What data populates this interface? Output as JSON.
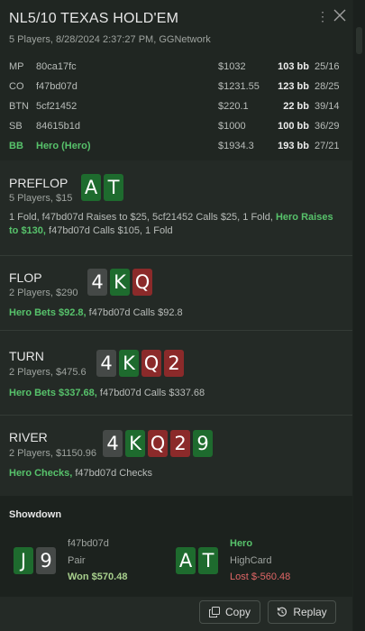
{
  "header": {
    "title": "NL5/10 TEXAS HOLD'EM",
    "subtitle": "5 Players, 8/28/2024 2:37:27 PM, GGNetwork"
  },
  "players": [
    {
      "pos": "MP",
      "name": "80ca17fc",
      "stack": "$1032",
      "bb": "103 bb",
      "stat": "25/16"
    },
    {
      "pos": "CO",
      "name": "f47bd07d",
      "stack": "$1231.55",
      "bb": "123 bb",
      "stat": "28/25"
    },
    {
      "pos": "BTN",
      "name": "5cf21452",
      "stack": "$220.1",
      "bb": "22 bb",
      "stat": "39/14"
    },
    {
      "pos": "SB",
      "name": "84615b1d",
      "stack": "$1000",
      "bb": "100 bb",
      "stat": "36/29"
    },
    {
      "pos": "BB",
      "name": "Hero (Hero)",
      "stack": "$1934.3",
      "bb": "193 bb",
      "stat": "27/21"
    }
  ],
  "streets": {
    "preflop": {
      "name": "PREFLOP",
      "info": "5 Players, $15",
      "cards": [
        {
          "rank": "A",
          "suit": "clubs"
        },
        {
          "rank": "T",
          "suit": "clubs"
        }
      ],
      "action_a": "1 Fold, f47bd07d Raises to $25, 5cf21452 Calls $25, 1 Fold, ",
      "action_hl": "Hero Raises to $130,",
      "action_b": " f47bd07d Calls $105, 1 Fold"
    },
    "flop": {
      "name": "FLOP",
      "info": "2 Players, $290",
      "cards": [
        {
          "rank": "4",
          "suit": "spades"
        },
        {
          "rank": "K",
          "suit": "clubs"
        },
        {
          "rank": "Q",
          "suit": "hearts"
        }
      ],
      "action_hl": "Hero Bets $92.8,",
      "action_b": " f47bd07d Calls $92.8"
    },
    "turn": {
      "name": "TURN",
      "info": "2 Players, $475.6",
      "cards": [
        {
          "rank": "4",
          "suit": "spades"
        },
        {
          "rank": "K",
          "suit": "clubs"
        },
        {
          "rank": "Q",
          "suit": "hearts"
        },
        {
          "rank": "2",
          "suit": "hearts"
        }
      ],
      "action_hl": "Hero Bets $337.68,",
      "action_b": " f47bd07d Calls $337.68"
    },
    "river": {
      "name": "RIVER",
      "info": "2 Players, $1150.96",
      "cards": [
        {
          "rank": "4",
          "suit": "spades"
        },
        {
          "rank": "K",
          "suit": "clubs"
        },
        {
          "rank": "Q",
          "suit": "hearts"
        },
        {
          "rank": "2",
          "suit": "hearts"
        },
        {
          "rank": "9",
          "suit": "clubs"
        }
      ],
      "action_hl": "Hero Checks,",
      "action_b": " f47bd07d Checks"
    }
  },
  "showdown": {
    "title": "Showdown",
    "villain": {
      "name": "f47bd07d",
      "hand": "Pair",
      "result": "Won $570.48",
      "cards": [
        {
          "rank": "J",
          "suit": "clubs"
        },
        {
          "rank": "9",
          "suit": "spades"
        }
      ]
    },
    "hero": {
      "name": "Hero",
      "hand": "HighCard",
      "result": "Lost $-560.48",
      "cards": [
        {
          "rank": "A",
          "suit": "clubs"
        },
        {
          "rank": "T",
          "suit": "clubs"
        }
      ]
    }
  },
  "footer": {
    "copy_label": "Copy",
    "replay_label": "Replay"
  },
  "colors": {
    "spades": "#454947",
    "clubs": "#1e6b2e",
    "hearts": "#8b2a2a",
    "accent_green": "#57c26b",
    "loss_red": "#e06666"
  },
  "icons": {
    "menu": "kebab-menu-icon",
    "close": "close-icon",
    "copy": "copy-icon",
    "replay": "replay-icon"
  }
}
